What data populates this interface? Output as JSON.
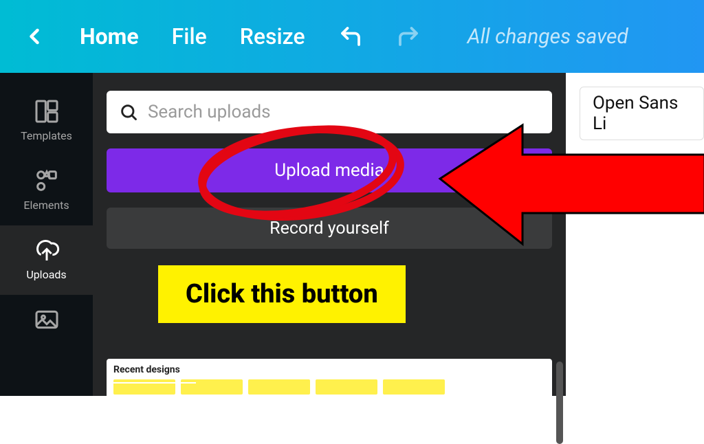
{
  "topbar": {
    "home": "Home",
    "file": "File",
    "resize": "Resize",
    "save_status": "All changes saved"
  },
  "sidebar": {
    "items": [
      {
        "label": "Templates"
      },
      {
        "label": "Elements"
      },
      {
        "label": "Uploads"
      },
      {
        "label": ""
      }
    ]
  },
  "panel": {
    "search_placeholder": "Search uploads",
    "upload_label": "Upload media",
    "record_label": "Record yourself",
    "recent_title": "Recent designs"
  },
  "canvas": {
    "font_label": "Open Sans Li"
  },
  "annotation": {
    "callout": "Click this button"
  }
}
